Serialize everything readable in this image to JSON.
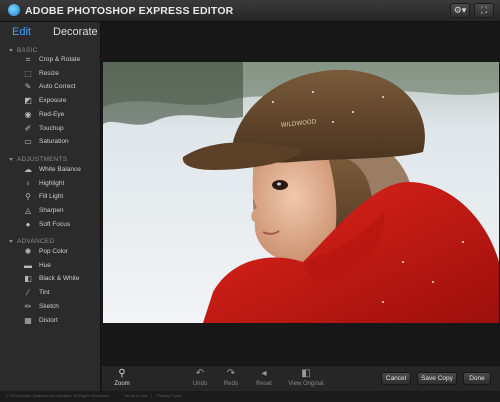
{
  "app": {
    "title": "ADOBE PHOTOSHOP EXPRESS EDITOR"
  },
  "titlebar": {
    "gear_icon": "gear-icon",
    "fullscreen_icon": "fullscreen-icon",
    "gear_symbol": "⚙▾",
    "fullscreen_symbol": "⛶"
  },
  "tabs": {
    "edit": "Edit",
    "decorate": "Decorate",
    "active": "edit",
    "active_color": "#3fa3ff"
  },
  "sections": {
    "basic": "BASIC",
    "adjustments": "ADJUSTMENTS",
    "advanced": "ADVANCED"
  },
  "basic_tools": [
    {
      "label": "Crop & Rotate",
      "icon": "crop-icon",
      "symbol": "⌗"
    },
    {
      "label": "Resize",
      "icon": "resize-icon",
      "symbol": "⬚"
    },
    {
      "label": "Auto Correct",
      "icon": "auto-correct-icon",
      "symbol": "✎"
    },
    {
      "label": "Exposure",
      "icon": "exposure-icon",
      "symbol": "◩"
    },
    {
      "label": "Red-Eye",
      "icon": "red-eye-icon",
      "symbol": "◉"
    },
    {
      "label": "Touchup",
      "icon": "touchup-icon",
      "symbol": "✐"
    },
    {
      "label": "Saturation",
      "icon": "saturation-icon",
      "symbol": "▭"
    }
  ],
  "adjustment_tools": [
    {
      "label": "White Balance",
      "icon": "white-balance-icon",
      "symbol": "☁"
    },
    {
      "label": "Highlight",
      "icon": "highlight-icon",
      "symbol": "♀"
    },
    {
      "label": "Fill Light",
      "icon": "fill-light-icon",
      "symbol": "⚲"
    },
    {
      "label": "Sharpen",
      "icon": "sharpen-icon",
      "symbol": "◬"
    },
    {
      "label": "Soft Focus",
      "icon": "soft-focus-icon",
      "symbol": "●"
    }
  ],
  "advanced_tools": [
    {
      "label": "Pop Color",
      "icon": "pop-color-icon",
      "symbol": "✺"
    },
    {
      "label": "Hue",
      "icon": "hue-icon",
      "symbol": "▬"
    },
    {
      "label": "Black & White",
      "icon": "black-white-icon",
      "symbol": "◧"
    },
    {
      "label": "Tint",
      "icon": "tint-icon",
      "symbol": "⁄"
    },
    {
      "label": "Sketch",
      "icon": "sketch-icon",
      "symbol": "✏"
    },
    {
      "label": "Distort",
      "icon": "distort-icon",
      "symbol": "▦"
    }
  ],
  "bottom": {
    "zoom": {
      "label": "Zoom",
      "icon": "zoom-icon",
      "symbol": "⚲"
    },
    "undo": {
      "label": "Undo",
      "icon": "undo-icon",
      "symbol": "↶"
    },
    "redo": {
      "label": "Redo",
      "icon": "redo-icon",
      "symbol": "↷"
    },
    "reset": {
      "label": "Reset",
      "icon": "reset-icon",
      "symbol": "◂"
    },
    "view_original": {
      "label": "View Original",
      "icon": "view-original-icon",
      "symbol": "◧"
    },
    "cancel": "Cancel",
    "save_copy": "Save Copy",
    "done": "Done"
  },
  "footer": {
    "copyright": "© 2008 Adobe Systems Incorporated. All Rights Reserved.",
    "terms": "Terms of Use",
    "separator": "|",
    "privacy": "Privacy Policy"
  }
}
